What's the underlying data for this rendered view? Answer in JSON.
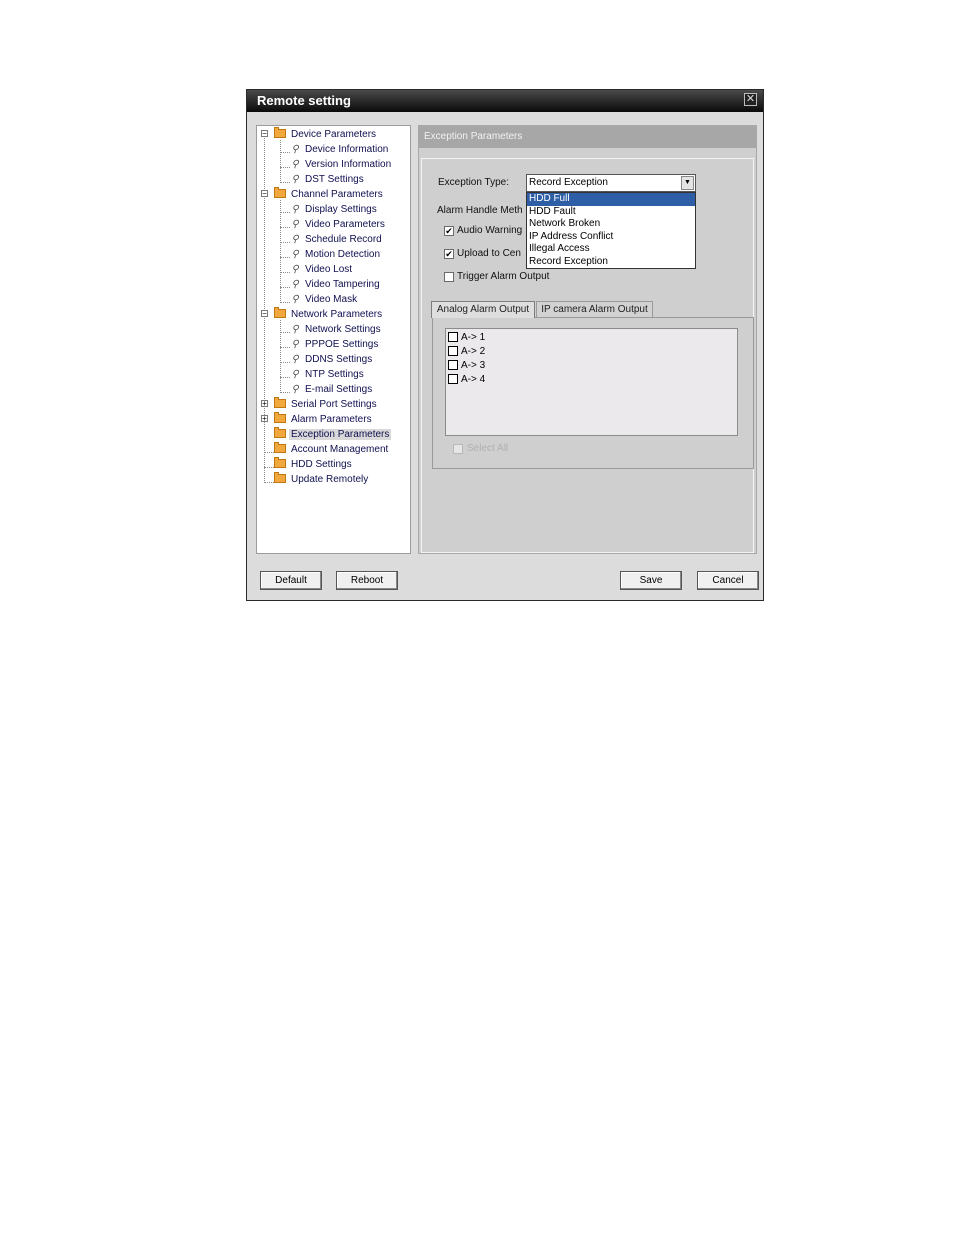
{
  "window": {
    "title": "Remote setting"
  },
  "tree": {
    "device_parameters": {
      "label": "Device Parameters",
      "children": [
        "Device Information",
        "Version Information",
        "DST Settings"
      ]
    },
    "channel_parameters": {
      "label": "Channel Parameters",
      "children": [
        "Display Settings",
        "Video Parameters",
        "Schedule Record",
        "Motion Detection",
        "Video Lost",
        "Video Tampering",
        "Video Mask"
      ]
    },
    "network_parameters": {
      "label": "Network Parameters",
      "children": [
        "Network Settings",
        "PPPOE Settings",
        "DDNS Settings",
        "NTP Settings",
        "E-mail Settings"
      ]
    },
    "serial_port_settings": "Serial Port Settings",
    "alarm_parameters": "Alarm Parameters",
    "exception_parameters": "Exception Parameters",
    "account_management": "Account Management",
    "hdd_settings": "HDD Settings",
    "update_remotely": "Update Remotely"
  },
  "panel": {
    "header": "Exception Parameters",
    "exception_type_label": "Exception Type:",
    "exception_type_value": "Record Exception",
    "dropdown_options": [
      "HDD Full",
      "HDD Fault",
      "Network Broken",
      "IP Address Conflict",
      "Illegal Access",
      "Record Exception"
    ],
    "dropdown_highlighted": "HDD Full",
    "alarm_handle_label": "Alarm Handle Meth",
    "audio_warning": {
      "label": "Audio Warning",
      "checked": true
    },
    "upload_to_center": {
      "label": "Upload to Cen",
      "checked": true
    },
    "trigger_alarm_output": {
      "label": "Trigger Alarm Output",
      "checked": false
    },
    "tabs": [
      "Analog Alarm Output",
      "IP camera Alarm Output"
    ],
    "active_tab": "Analog Alarm Output",
    "outputs": [
      "A-> 1",
      "A-> 2",
      "A-> 3",
      "A-> 4"
    ],
    "select_all": "Select All"
  },
  "buttons": {
    "default": "Default",
    "reboot": "Reboot",
    "save": "Save",
    "cancel": "Cancel"
  },
  "colors": {
    "titlebar": "#0a0a0a",
    "dropdown_selection": "#2e5fa6",
    "folder": "#f1a83c"
  }
}
